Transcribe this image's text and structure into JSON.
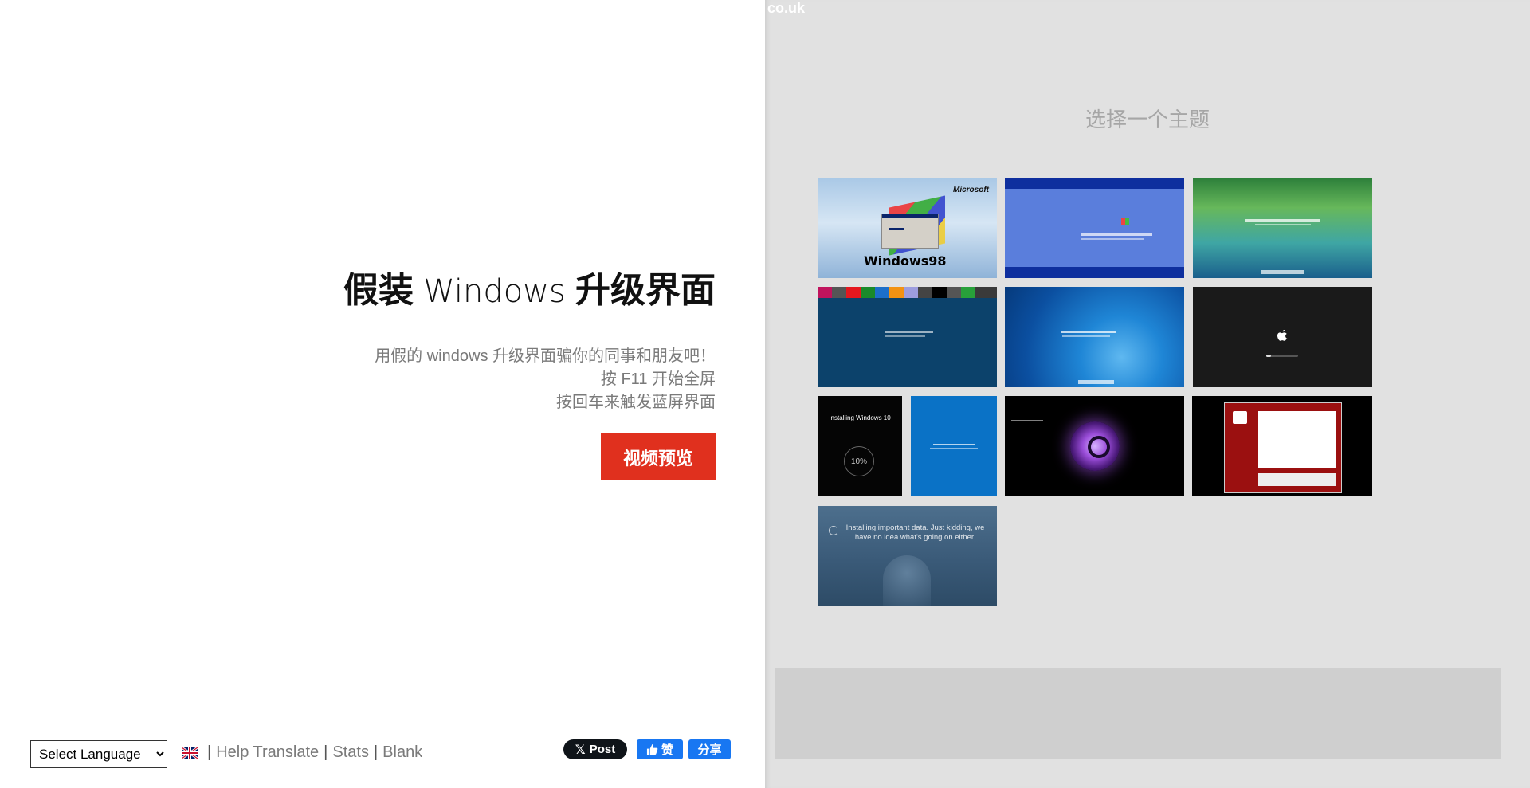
{
  "domain_fragment": "co.uk",
  "hero": {
    "title_part1": "假装",
    "title_part2": "Windows",
    "title_part3": "升级界面",
    "desc_line1": "用假的 windows 升级界面骗你的同事和朋友吧！",
    "desc_line2": "按 F11 开始全屏",
    "desc_line3": "按回车来触发蓝屏界面",
    "preview_button": "视频预览"
  },
  "footer": {
    "language_select": "Select Language",
    "help_translate": "Help Translate",
    "stats": "Stats",
    "blank": "Blank",
    "separator": "|"
  },
  "social": {
    "x_post": "Post",
    "fb_like": "赞",
    "fb_share": "分享",
    "x_color": "#0f1419",
    "fb_color": "#1877f2"
  },
  "themes": {
    "title": "选择一个主题",
    "win98": {
      "brand": "Microsoft",
      "logo": "Windows98"
    },
    "win10_installing": {
      "label": "Installing Windows 10",
      "percent": "10%"
    },
    "crazy": {
      "line1": "Installing important data. Just kidding, we",
      "line2": "have no idea what's going on either."
    }
  },
  "colors": {
    "accent_button": "#e0301e",
    "right_panel": "#e1e1e1"
  }
}
